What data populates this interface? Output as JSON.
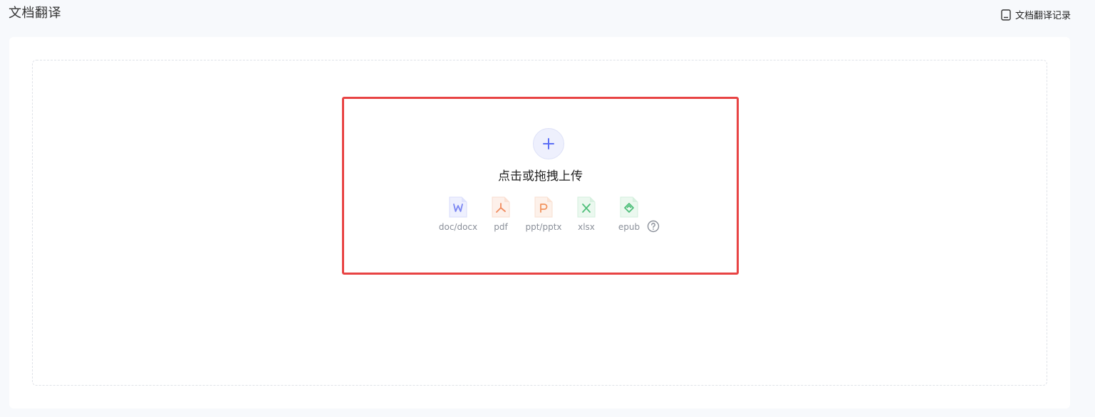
{
  "header": {
    "title": "文档翻译",
    "history_label": "文档翻译记录",
    "history_icon": "document-record-icon"
  },
  "upload": {
    "icon": "plus-icon",
    "prompt": "点击或拖拽上传",
    "accent": "#5b6ef5",
    "border_color": "#e84343",
    "help_icon": "question-circle-icon"
  },
  "file_types": [
    {
      "label": "doc/docx",
      "icon": "word-file-icon",
      "color": "#7b86f2"
    },
    {
      "label": "pdf",
      "icon": "pdf-file-icon",
      "color": "#f08a5d"
    },
    {
      "label": "ppt/pptx",
      "icon": "ppt-file-icon",
      "color": "#f2935c"
    },
    {
      "label": "xlsx",
      "icon": "excel-file-icon",
      "color": "#4fbf7a"
    },
    {
      "label": "epub",
      "icon": "epub-file-icon",
      "color": "#4fbf7a"
    }
  ]
}
